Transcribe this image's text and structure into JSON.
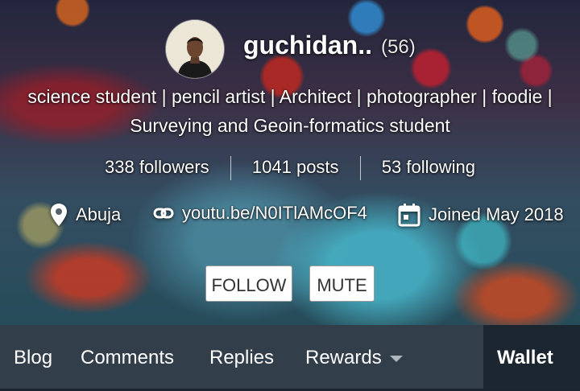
{
  "profile": {
    "name": "guchidan..",
    "reputation": "(56)",
    "about": "science student | pencil artist | Architect | photographer | foodie | Surveying and Geoin-formatics student",
    "followers": "338 followers",
    "posts": "1041 posts",
    "following": "53 following",
    "location": "Abuja",
    "website": "youtu.be/N0ITlAMcOF4",
    "joined": "Joined May 2018"
  },
  "actions": {
    "follow_label": "FOLLOW",
    "mute_label": "MUTE"
  },
  "tabs": [
    {
      "label": "Blog"
    },
    {
      "label": "Comments"
    },
    {
      "label": "Replies"
    },
    {
      "label": "Rewards"
    },
    {
      "label": "Wallet",
      "active": true
    }
  ],
  "icons": {
    "location": "map-pin-icon",
    "website": "link-icon",
    "joined": "calendar-icon",
    "rewards_dropdown": "caret-down-icon"
  },
  "colors": {
    "tab_bar": "#323e4a",
    "active_tab": "#1c2630",
    "button_bg": "#ffffff"
  }
}
